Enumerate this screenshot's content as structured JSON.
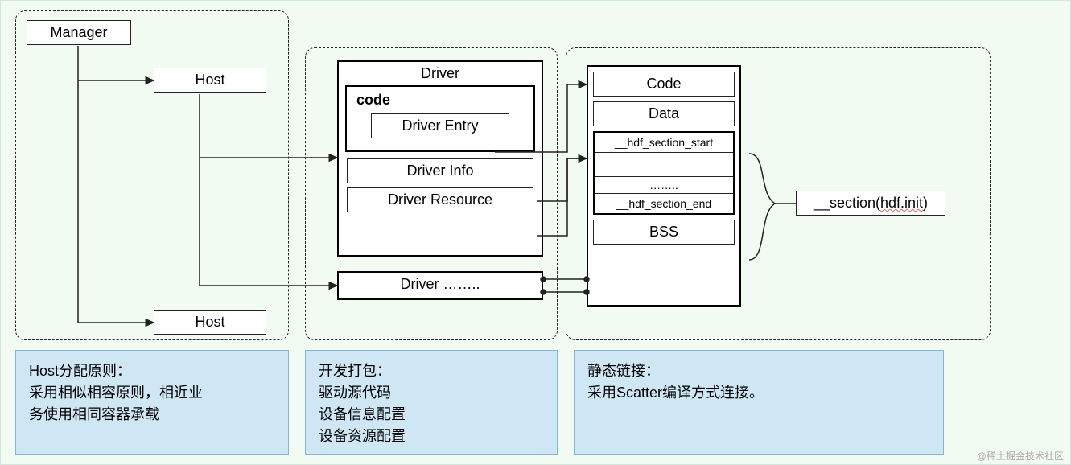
{
  "panel_left": {
    "manager": "Manager",
    "host1": "Host",
    "host2": "Host"
  },
  "panel_mid": {
    "driver_group_title": "Driver",
    "code_label": "code",
    "driver_entry": "Driver Entry",
    "driver_info": "Driver Info",
    "driver_resource": "Driver Resource",
    "driver_more": "Driver …….."
  },
  "panel_right": {
    "code": "Code",
    "data": "Data",
    "hdf_start": "__hdf_section_start",
    "hdf_mid": "……..",
    "hdf_end": "__hdf_section_end",
    "bss": "BSS",
    "section_text": "__section(",
    "section_arg": "hdf.init",
    "section_close": ")"
  },
  "captions": {
    "left_title": "Host分配原则：",
    "left_line1": "采用相似相容原则，相近业",
    "left_line2": "务使用相同容器承载",
    "mid_title": "开发打包：",
    "mid_line1": "驱动源代码",
    "mid_line2": "设备信息配置",
    "mid_line3": "设备资源配置",
    "right_title": "静态链接：",
    "right_line1": "采用Scatter编译方式连接。"
  },
  "watermark": "@稀土掘金技术社区"
}
